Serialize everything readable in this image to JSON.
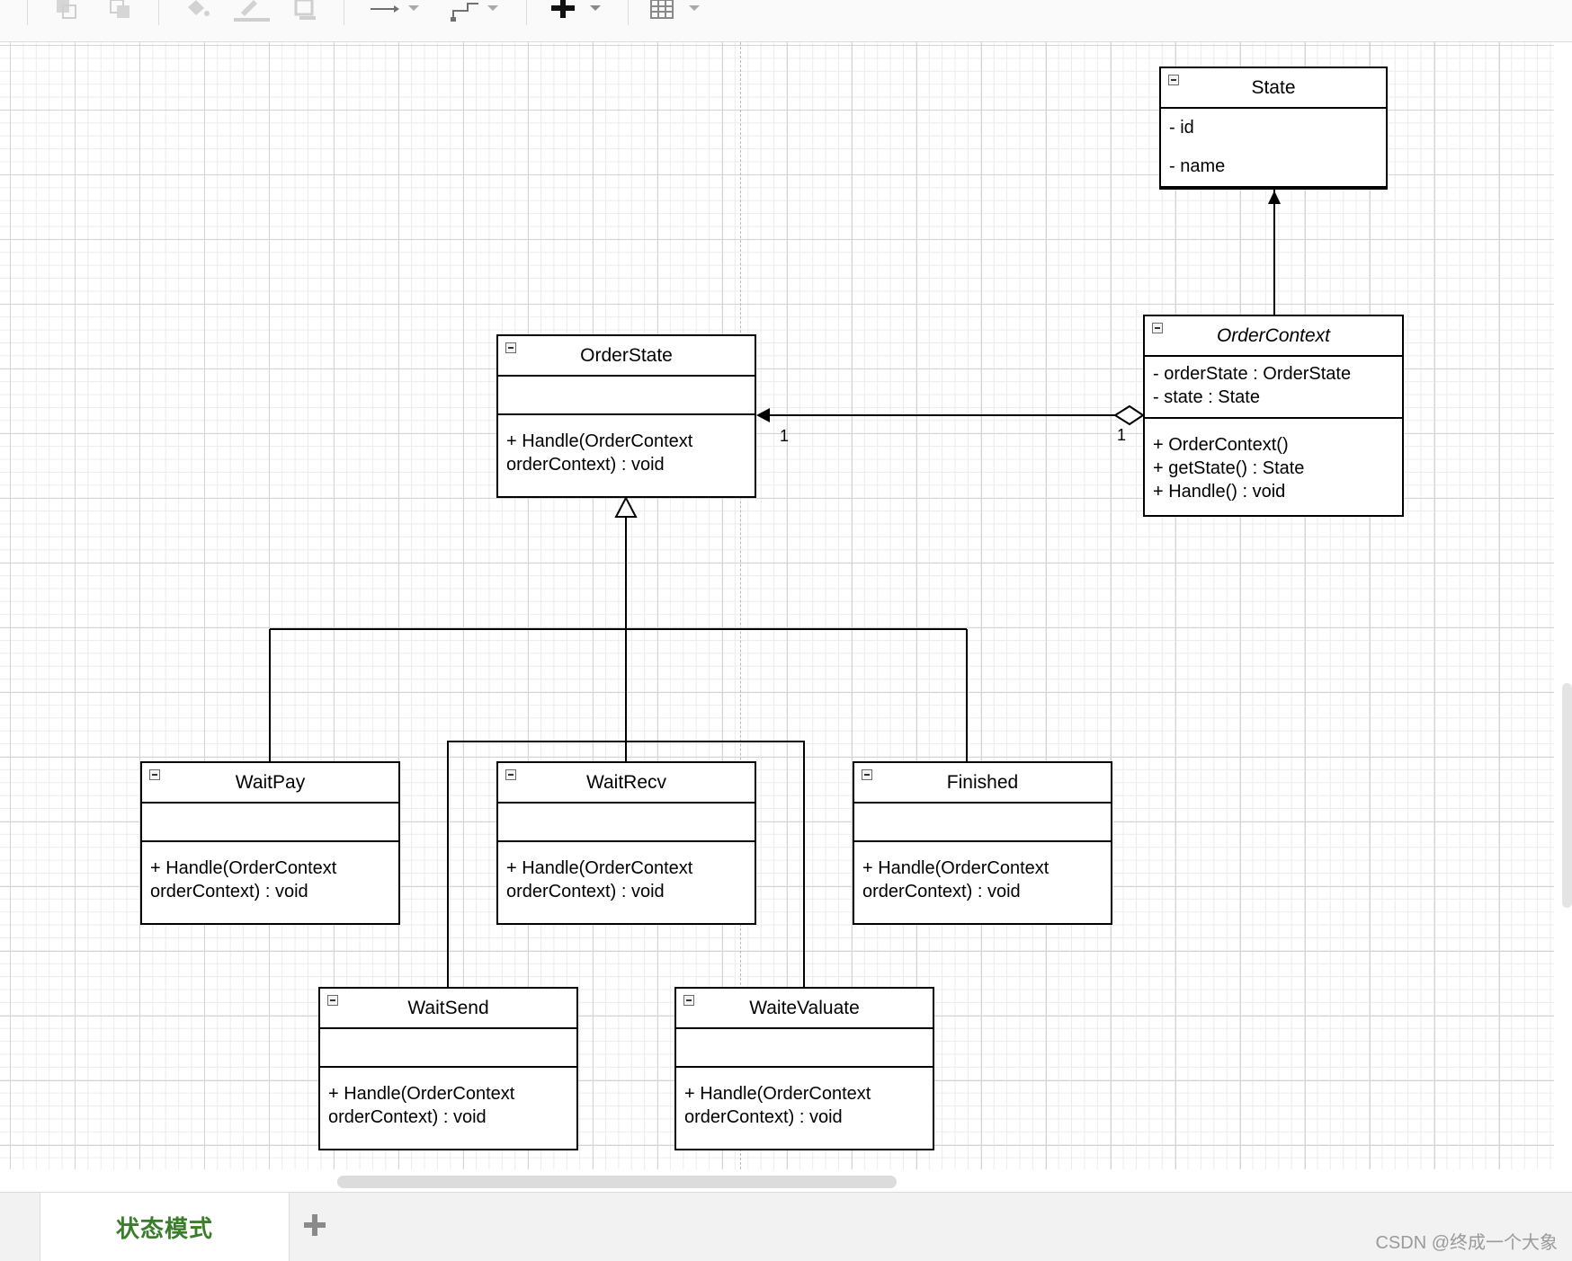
{
  "toolbar": {
    "icons": [
      "to-front-icon",
      "to-back-icon",
      "fill-color-icon",
      "line-color-icon",
      "shadow-icon",
      "connection-arrow-icon",
      "waypoint-icon",
      "insert-plus-icon",
      "table-icon"
    ]
  },
  "diagram": {
    "classes": {
      "state": {
        "name": "State",
        "attributes": [
          "- id",
          "- name"
        ],
        "methods": []
      },
      "order_context": {
        "name": "OrderContext",
        "attributes": [
          "- orderState : OrderState",
          "- state : State"
        ],
        "methods": [
          "+ OrderContext()",
          "+ getState() : State",
          "+ Handle() : void"
        ]
      },
      "order_state": {
        "name": "OrderState",
        "attributes": [],
        "methods": [
          "+ Handle(OrderContext",
          "orderContext) : void"
        ]
      },
      "wait_pay": {
        "name": "WaitPay",
        "attributes": [],
        "methods": [
          "+ Handle(OrderContext",
          "orderContext) : void"
        ]
      },
      "wait_recv": {
        "name": "WaitRecv",
        "attributes": [],
        "methods": [
          "+ Handle(OrderContext",
          "orderContext) : void"
        ]
      },
      "finished": {
        "name": "Finished",
        "attributes": [],
        "methods": [
          "+ Handle(OrderContext",
          "orderContext) : void"
        ]
      },
      "wait_send": {
        "name": "WaitSend",
        "attributes": [],
        "methods": [
          "+ Handle(OrderContext",
          "orderContext) : void"
        ]
      },
      "waite_valuate": {
        "name": "WaiteValuate",
        "attributes": [],
        "methods": [
          "+ Handle(OrderContext",
          "orderContext) : void"
        ]
      }
    },
    "associations": {
      "multiplicity_source": "1",
      "multiplicity_target": "1"
    }
  },
  "colors": {
    "tab_active_text": "#3a7d2b",
    "grid_major": "#d4d4d4",
    "grid_minor": "#ececec"
  },
  "tabs": {
    "active": "状态模式"
  },
  "watermark": "CSDN @终成一个大象"
}
